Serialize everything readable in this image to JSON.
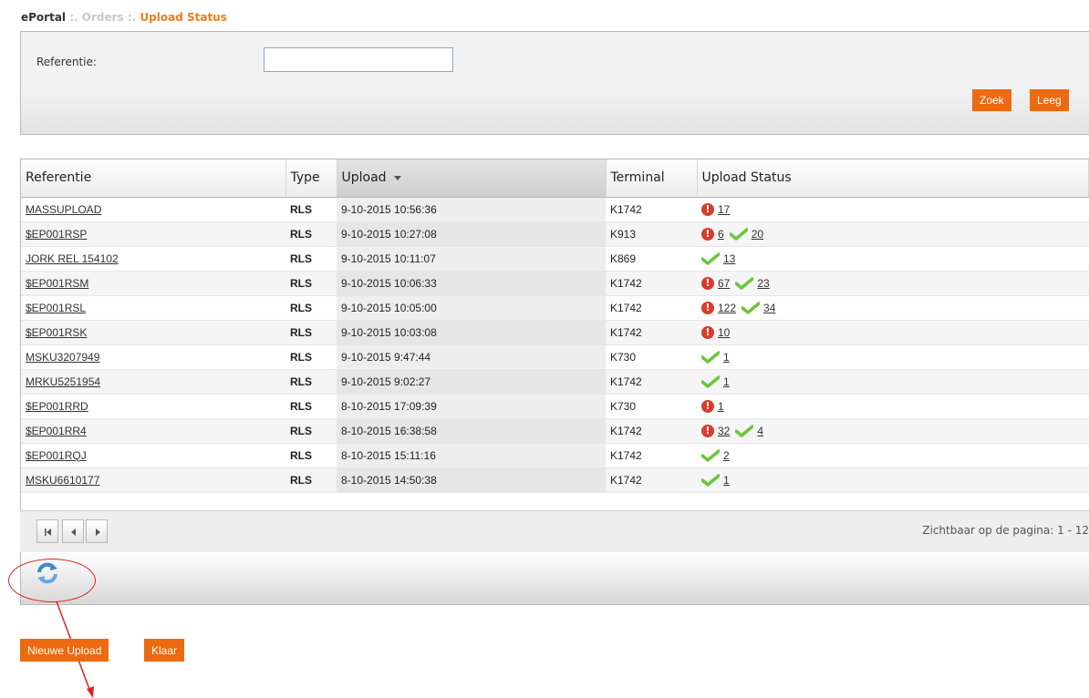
{
  "breadcrumb": {
    "root": "ePortal",
    "sep1": " :. ",
    "mid": "Orders",
    "sep2": " :. ",
    "current": "Upload Status"
  },
  "search": {
    "label": "Referentie:",
    "value": "",
    "search_button": "Zoek",
    "clear_button": "Leeg"
  },
  "grid": {
    "columns": [
      "Referentie",
      "Type",
      "Upload",
      "Terminal",
      "Upload Status"
    ],
    "sorted_column": "Upload",
    "rows": [
      {
        "ref": "MASSUPLOAD",
        "type": "RLS",
        "upload": "9-10-2015 10:56:36",
        "terminal": "K1742",
        "errors": "17",
        "ok": ""
      },
      {
        "ref": "$EP001RSP",
        "type": "RLS",
        "upload": "9-10-2015 10:27:08",
        "terminal": "K913",
        "errors": "6",
        "ok": "20"
      },
      {
        "ref": "JORK REL 154102",
        "type": "RLS",
        "upload": "9-10-2015 10:11:07",
        "terminal": "K869",
        "errors": "",
        "ok": "13"
      },
      {
        "ref": "$EP001RSM",
        "type": "RLS",
        "upload": "9-10-2015 10:06:33",
        "terminal": "K1742",
        "errors": "67",
        "ok": "23"
      },
      {
        "ref": "$EP001RSL",
        "type": "RLS",
        "upload": "9-10-2015 10:05:00",
        "terminal": "K1742",
        "errors": "122",
        "ok": "34"
      },
      {
        "ref": "$EP001RSK",
        "type": "RLS",
        "upload": "9-10-2015 10:03:08",
        "terminal": "K1742",
        "errors": "10",
        "ok": ""
      },
      {
        "ref": "MSKU3207949",
        "type": "RLS",
        "upload": "9-10-2015 9:47:44",
        "terminal": "K730",
        "errors": "",
        "ok": "1"
      },
      {
        "ref": "MRKU5251954",
        "type": "RLS",
        "upload": "9-10-2015 9:02:27",
        "terminal": "K1742",
        "errors": "",
        "ok": "1"
      },
      {
        "ref": "$EP001RRD",
        "type": "RLS",
        "upload": "8-10-2015 17:09:39",
        "terminal": "K730",
        "errors": "1",
        "ok": ""
      },
      {
        "ref": "$EP001RR4",
        "type": "RLS",
        "upload": "8-10-2015 16:38:58",
        "terminal": "K1742",
        "errors": "32",
        "ok": "4"
      },
      {
        "ref": "$EP001RQJ",
        "type": "RLS",
        "upload": "8-10-2015 15:11:16",
        "terminal": "K1742",
        "errors": "",
        "ok": "2"
      },
      {
        "ref": "MSKU6610177",
        "type": "RLS",
        "upload": "8-10-2015 14:50:38",
        "terminal": "K1742",
        "errors": "",
        "ok": "1"
      }
    ]
  },
  "pager": {
    "info": "Zichtbaar op de pagina: 1 - 12"
  },
  "actions": {
    "new_upload": "Nieuwe Upload",
    "done": "Klaar"
  },
  "icons": {
    "first": "first-page-icon",
    "prev": "prev-page-icon",
    "next": "next-page-icon",
    "refresh": "refresh-icon",
    "error": "error-icon",
    "ok": "checkmark-icon"
  },
  "colors": {
    "accent": "#ec6a10",
    "breadcrumb_current": "#f07d1a",
    "error": "#d83d2c",
    "ok": "#6cc63a",
    "annotation": "#e02020"
  }
}
